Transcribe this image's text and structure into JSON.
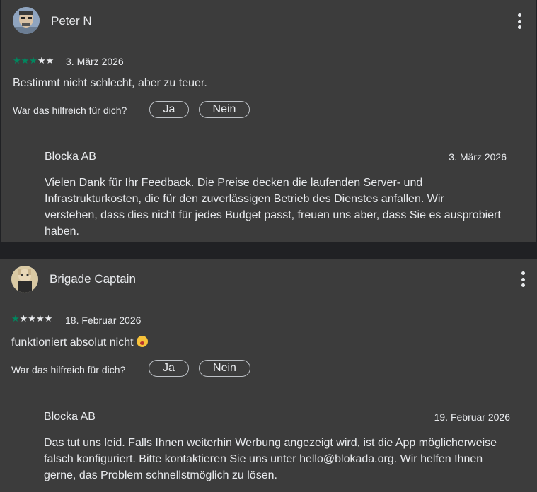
{
  "reviews": [
    {
      "author": "Peter N",
      "rating": 3,
      "stars": "★★★★★",
      "date": "3. März 2026",
      "text": "Bestimmt nicht schlecht, aber zu teuer.",
      "helpful_question": "War das hilfreich für dich?",
      "yes_label": "Ja",
      "no_label": "Nein",
      "reply": {
        "developer": "Blocka AB",
        "date": "3. März 2026",
        "lines": [
          "Vielen Dank für Ihr Feedback. Die Preise decken die laufenden Server- und",
          "Infrastrukturkosten, die für den zuverlässigen Betrieb des Dienstes anfallen. Wir",
          "verstehen, dass dies nicht für jedes Budget passt, freuen uns aber, dass Sie es ausprobiert",
          "haben."
        ]
      }
    },
    {
      "author": "Brigade Captain",
      "rating": 1,
      "stars": "★★★★★",
      "date": "18. Februar 2026",
      "text": "funktioniert absolut nicht",
      "emoji": "flushed-face-emoji",
      "helpful_question": "War das hilfreich für dich?",
      "yes_label": "Ja",
      "no_label": "Nein",
      "reply": {
        "developer": "Blocka AB",
        "date": "19. Februar 2026",
        "lines": [
          "Das tut uns leid. Falls Ihnen weiterhin Werbung angezeigt wird, ist die App möglicherweise",
          "falsch konfiguriert. Bitte kontaktieren Sie uns unter hello@blokada.org. Wir helfen Ihnen",
          "gerne, das Problem schnellstmöglich zu lösen."
        ]
      }
    }
  ],
  "colors": {
    "background": "#202124",
    "card": "#3c3c3c",
    "star_filled": "#01875f",
    "text": "#e8eaed"
  },
  "icons": {
    "menu": "more-vert-icon"
  }
}
